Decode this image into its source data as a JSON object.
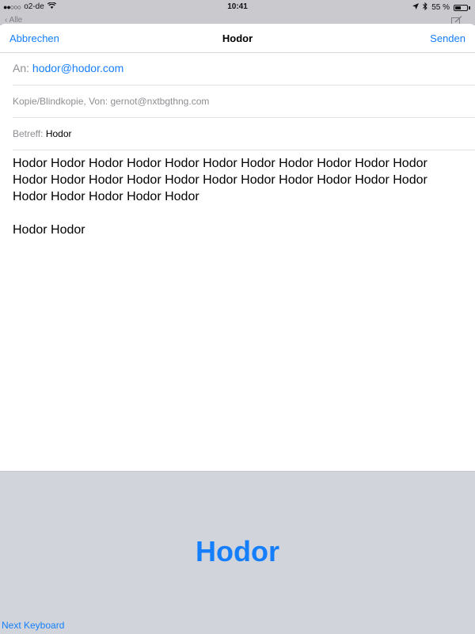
{
  "status_bar": {
    "signal": "●●○○○",
    "carrier": "o2-de",
    "wifi_icon": "wifi-icon",
    "time": "10:41",
    "location_icon": "location-arrow-icon",
    "bluetooth_icon": "bluetooth-icon",
    "battery": "55 %",
    "battery_level": 0.55
  },
  "behind": {
    "back_label": "‹ Alle",
    "compose_icon": "compose-icon"
  },
  "nav": {
    "cancel_label": "Abbrechen",
    "title": "Hodor",
    "send_label": "Senden"
  },
  "fields": {
    "to_label": "An:",
    "to_value": "hodor@hodor.com",
    "cc_label": "Kopie/Blindkopie, Von:",
    "cc_value": "gernot@nxtbgthng.com",
    "subject_label": "Betreff:",
    "subject_value": "Hodor"
  },
  "body": {
    "paragraph1": "Hodor Hodor Hodor Hodor Hodor Hodor Hodor Hodor Hodor Hodor Hodor Hodor Hodor Hodor Hodor Hodor Hodor Hodor Hodor Hodor Hodor Hodor Hodor Hodor Hodor Hodor Hodor",
    "paragraph2": "Hodor Hodor"
  },
  "keyboard": {
    "key_label": "Hodor",
    "next_keyboard_label": "Next Keyboard"
  },
  "colors": {
    "accent": "#157efb",
    "keyboard_bg": "#d1d5db",
    "label_gray": "#8e8e93"
  }
}
